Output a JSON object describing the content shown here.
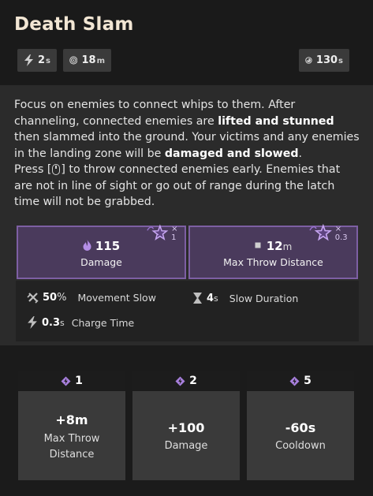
{
  "ability": {
    "title": "Death Slam",
    "stats": {
      "cast_value": "2",
      "cast_unit": "s",
      "range_value": "18",
      "range_unit": "m",
      "cooldown_value": "130",
      "cooldown_unit": "s"
    }
  },
  "description": {
    "line1_a": "Focus on enemies to connect whips to them. After channeling, connected enemies are ",
    "line1_bold": "lifted and stunned",
    "line1_b": " then slammed into the ground. Your victims and any enemies in the landing zone will be ",
    "line1_bold2": "damaged and slowed",
    "line1_c": ".",
    "line2_a": "Press [",
    "line2_b": "] to throw connected enemies early. Enemies that are not in line of sight or go out of range during the latch time will not be grabbed.",
    "key_icon": "mouse-icon"
  },
  "primary_stats": [
    {
      "value": "115",
      "unit": "",
      "label": "Damage",
      "multiplier": "× 1",
      "icon": "soul-flame-icon"
    },
    {
      "value": "12",
      "unit": "m",
      "label": "Max Throw Distance",
      "multiplier": "× 0.3",
      "icon": "square-icon"
    }
  ],
  "secondary_stats": [
    {
      "value": "50",
      "unit": "%",
      "label": "Movement Slow",
      "icon": "slow-icon"
    },
    {
      "value": "4",
      "unit": "s",
      "label": "Slow Duration",
      "icon": "hourglass-icon"
    },
    {
      "value": "0.3",
      "unit": "s",
      "label": "Charge Time",
      "icon": "bolt-icon"
    }
  ],
  "upgrades": [
    {
      "tier": "1",
      "value": "+8m",
      "label_line1": "Max Throw",
      "label_line2": "Distance"
    },
    {
      "tier": "2",
      "value": "+100",
      "label_line1": "Damage",
      "label_line2": ""
    },
    {
      "tier": "5",
      "value": "-60s",
      "label_line1": "Cooldown",
      "label_line2": ""
    }
  ],
  "colors": {
    "accent_purple": "#7d5fa3",
    "box_purple": "#4a3a5c",
    "tier_purple": "#a77fdc",
    "title_cream": "#f2e6d4"
  }
}
